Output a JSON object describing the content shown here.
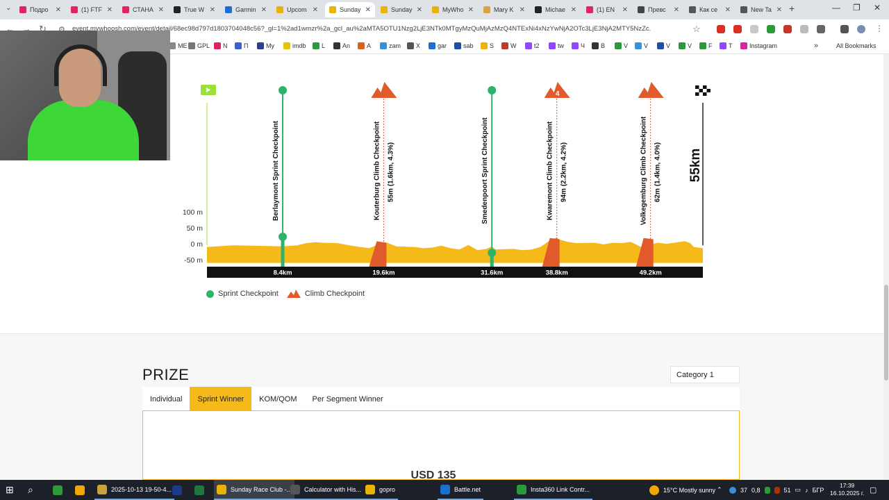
{
  "browser": {
    "tabs": [
      {
        "title": "Подро",
        "color": "#e0245e"
      },
      {
        "title": "(1) FTF",
        "color": "#e0245e"
      },
      {
        "title": "СТАНА",
        "color": "#e0245e"
      },
      {
        "title": "True W",
        "color": "#222222"
      },
      {
        "title": "Garmin",
        "color": "#1b6fd1"
      },
      {
        "title": "Upcom",
        "color": "#e8b400"
      },
      {
        "title": "Sunday",
        "color": "#e8b400",
        "active": true
      },
      {
        "title": "Sunday",
        "color": "#e8b400"
      },
      {
        "title": "MyWho",
        "color": "#e8b400"
      },
      {
        "title": "Mary K",
        "color": "#d9a440"
      },
      {
        "title": "Michae",
        "color": "#222222"
      },
      {
        "title": "(1) EN",
        "color": "#e0245e"
      },
      {
        "title": "Превс",
        "color": "#444444"
      },
      {
        "title": "Как се",
        "color": "#555555"
      },
      {
        "title": "New Ta",
        "color": "#555555"
      }
    ],
    "tab_close": "✕",
    "new_tab": "+",
    "url": "event.mywhoosh.com/event/detail/68ec98d797d1803704048c56?_gl=1%2ad1wmzr%2a_gcl_au%2aMTA5OTU1Nzg2LjE3NTk0MTgyMzQuMjAzMzQ4NTExNi4xNzYwNjA2OTc3LjE3NjA2MTY5NzZc.",
    "bookmarks": [
      {
        "label": "ME",
        "color": "#888888"
      },
      {
        "label": "GPL",
        "color": "#777777"
      },
      {
        "label": "N",
        "color": "#e0245e"
      },
      {
        "label": "П",
        "color": "#3a63c9"
      },
      {
        "label": "My",
        "color": "#2c3e8c"
      },
      {
        "label": "imdb",
        "color": "#e8c100"
      },
      {
        "label": "L",
        "color": "#2a9a3a"
      },
      {
        "label": "An",
        "color": "#333333"
      },
      {
        "label": "A",
        "color": "#d9631c"
      },
      {
        "label": "zam",
        "color": "#3a8fd9"
      },
      {
        "label": "X",
        "color": "#555555"
      },
      {
        "label": "gar",
        "color": "#1b6fd1"
      },
      {
        "label": "sab",
        "color": "#1b4fa8"
      },
      {
        "label": "S",
        "color": "#f0b400"
      },
      {
        "label": "W",
        "color": "#c0392b"
      },
      {
        "label": "t2",
        "color": "#9146ff"
      },
      {
        "label": "tw",
        "color": "#9146ff"
      },
      {
        "label": "Ч",
        "color": "#9146ff"
      },
      {
        "label": "B",
        "color": "#333333"
      },
      {
        "label": "V",
        "color": "#2a9a3a"
      },
      {
        "label": "V",
        "color": "#3a8fd9"
      },
      {
        "label": "V",
        "color": "#1b4fa8"
      },
      {
        "label": "V",
        "color": "#2a9a3a"
      },
      {
        "label": "F",
        "color": "#2a9a3a"
      },
      {
        "label": "T",
        "color": "#9146ff"
      },
      {
        "label": "Instagram",
        "color": "#d6249f"
      }
    ],
    "bookmarks_more": "»",
    "all_bookmarks": "All Bookmarks"
  },
  "profile": {
    "y_labels": [
      "100 m",
      "50 m",
      "0 m",
      "-50 m"
    ],
    "y_values": [
      100,
      50,
      0,
      -50
    ],
    "finish_label": "55km",
    "checkpoints": [
      {
        "type": "sprint",
        "name": "Berlaymont Sprint Checkpoint",
        "detail": "",
        "km": 8.4,
        "km_label": "8.4km"
      },
      {
        "type": "climb",
        "name": "Kouterburg Climb Checkpoint",
        "detail": "55m (1.6km, 4.3%)",
        "km": 19.6,
        "km_label": "19.6km"
      },
      {
        "type": "sprint",
        "name": "Smedenpoort Sprint Checkpoint",
        "detail": "",
        "km": 31.6,
        "km_label": "31.6km"
      },
      {
        "type": "climb",
        "name": "Kwaremont Climb Checkpoint",
        "detail": "94m (2.2km, 4.2%)",
        "km": 38.8,
        "km_label": "38.8km",
        "badge": "4"
      },
      {
        "type": "climb",
        "name": "Volkegemburg Climb Checkpoint",
        "detail": "62m (1.4km, 4.0%)",
        "km": 49.2,
        "km_label": "49.2km"
      }
    ],
    "colors": {
      "sprint": "#2fb36a",
      "climb": "#e05a2b",
      "elevation": "#f5b91a",
      "start": "#9be03a"
    }
  },
  "legend": {
    "sprint": "Sprint Checkpoint",
    "climb": "Climb Checkpoint"
  },
  "prize": {
    "title": "PRIZE",
    "category": "Category 1",
    "tabs": [
      {
        "label": "Individual",
        "active": false
      },
      {
        "label": "Sprint Winner",
        "active": true
      },
      {
        "label": "KOM/QOM",
        "active": false
      },
      {
        "label": "Per Segment Winner",
        "active": false
      }
    ],
    "amount": "USD 135"
  },
  "taskbar": {
    "items": [
      {
        "label": "",
        "color": "#2e9a3a"
      },
      {
        "label": "",
        "color": "#f0a800"
      },
      {
        "label": "2025-10-13 19-50-4...",
        "color": "#c8a23a"
      },
      {
        "label": "",
        "color": "#1c3a8c"
      },
      {
        "label": "",
        "color": "#1e7a3c"
      },
      {
        "label": "Sunday Race Club -...",
        "color": "#e8b400"
      },
      {
        "label": "Calculator with His...",
        "color": "#555555"
      },
      {
        "label": "gopro",
        "color": "#e8b400"
      },
      {
        "label": "Battle.net",
        "color": "#1b6fd1"
      },
      {
        "label": "Insta360 Link Contr...",
        "color": "#2a9a3a"
      }
    ],
    "weather": "15°C  Mostly sunny",
    "tray": [
      "37",
      "0,8",
      "51",
      "БГР"
    ],
    "time": "17:39",
    "date": "16.10.2025 г."
  }
}
